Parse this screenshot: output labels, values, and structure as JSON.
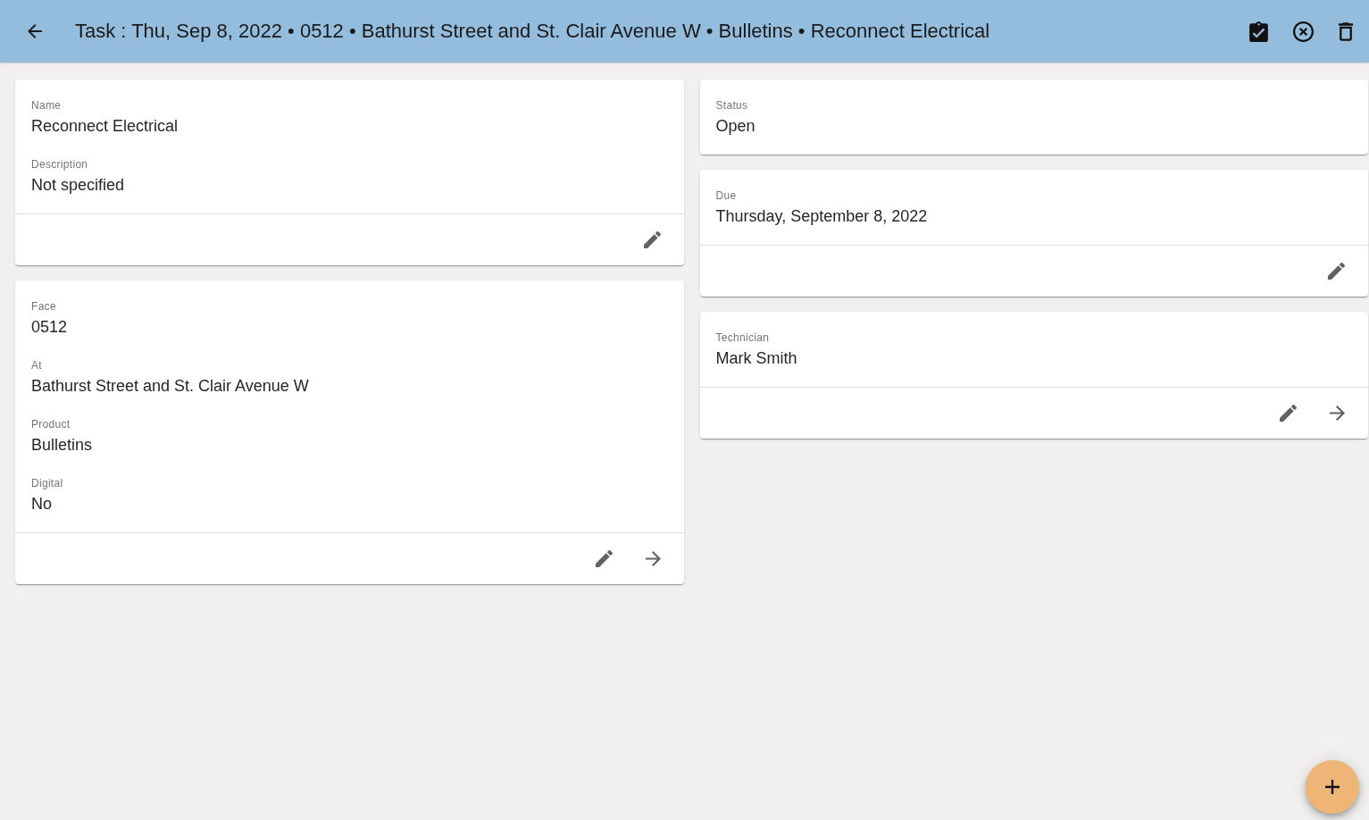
{
  "app_bar": {
    "title": "Task : Thu, Sep 8, 2022 • 0512 • Bathurst Street and St. Clair Avenue W • Bulletins • Reconnect Electrical"
  },
  "columns": [
    {
      "cards": [
        {
          "fields": [
            {
              "label": "Name",
              "value": "Reconnect Electrical"
            },
            {
              "label": "Description",
              "value": "Not specified"
            }
          ],
          "editable": true,
          "navigable": false
        },
        {
          "fields": [
            {
              "label": "Face",
              "value": "0512"
            },
            {
              "label": "At",
              "value": "Bathurst Street and St. Clair Avenue W"
            },
            {
              "label": "Product",
              "value": "Bulletins"
            },
            {
              "label": "Digital",
              "value": "No"
            }
          ],
          "editable": true,
          "navigable": true
        }
      ]
    },
    {
      "cards": [
        {
          "fields": [
            {
              "label": "Status",
              "value": "Open"
            }
          ],
          "editable": false,
          "navigable": false
        },
        {
          "fields": [
            {
              "label": "Due",
              "value": "Thursday, September 8, 2022"
            }
          ],
          "editable": true,
          "navigable": false
        },
        {
          "fields": [
            {
              "label": "Technician",
              "value": "Mark Smith"
            }
          ],
          "editable": true,
          "navigable": true
        }
      ]
    }
  ]
}
